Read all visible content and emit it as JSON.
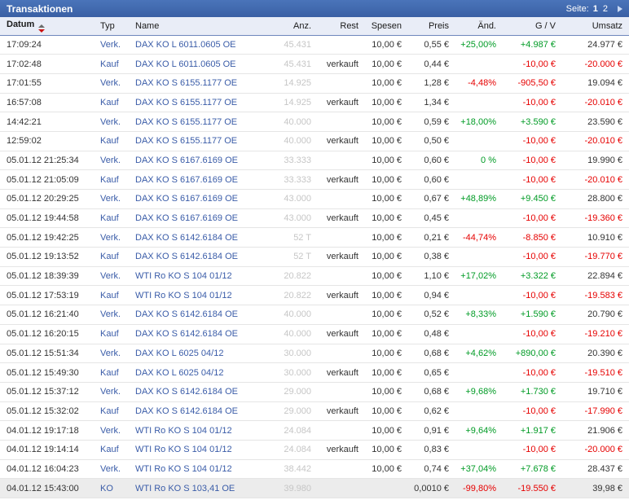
{
  "titlebar": {
    "title": "Transaktionen",
    "page_label": "Seite:",
    "pages": [
      {
        "label": "1",
        "current": true
      },
      {
        "label": "2",
        "current": false
      }
    ],
    "next_page_icon": "next-page-arrow"
  },
  "colors": {
    "titlebar_top": "#4a74ba",
    "titlebar_bottom": "#3a60a4",
    "header_bg": "#e9edf7",
    "link_blue": "#3a5ca8",
    "positive_green": "#009b25",
    "negative_red": "#e60000",
    "muted_grey": "#c6c6c6",
    "highlight_row": "#ececec"
  },
  "table": {
    "columns": [
      "Datum",
      "Typ",
      "Name",
      "Anz.",
      "Rest",
      "Spesen",
      "Preis",
      "Änd.",
      "G / V",
      "Umsatz"
    ],
    "sorted_column": "Datum",
    "sort_icon": "sort-arrows",
    "rows": [
      {
        "datum": "17:09:24",
        "typ": "Verk.",
        "name": "DAX KO L 6011.0605 OE",
        "anz": "45.431",
        "rest": "",
        "spesen": "10,00 €",
        "preis": "0,55 €",
        "aend": "+25,00%",
        "gv": "+4.987 €",
        "umsatz": "24.977 €"
      },
      {
        "datum": "17:02:48",
        "typ": "Kauf",
        "name": "DAX KO L 6011.0605 OE",
        "anz": "45.431",
        "rest": "verkauft",
        "spesen": "10,00 €",
        "preis": "0,44 €",
        "aend": "",
        "gv": "-10,00 €",
        "umsatz": "-20.000 €"
      },
      {
        "datum": "17:01:55",
        "typ": "Verk.",
        "name": "DAX KO S 6155.1177 OE",
        "anz": "14.925",
        "rest": "",
        "spesen": "10,00 €",
        "preis": "1,28 €",
        "aend": "-4,48%",
        "gv": "-905,50 €",
        "umsatz": "19.094 €"
      },
      {
        "datum": "16:57:08",
        "typ": "Kauf",
        "name": "DAX KO S 6155.1177 OE",
        "anz": "14.925",
        "rest": "verkauft",
        "spesen": "10,00 €",
        "preis": "1,34 €",
        "aend": "",
        "gv": "-10,00 €",
        "umsatz": "-20.010 €"
      },
      {
        "datum": "14:42:21",
        "typ": "Verk.",
        "name": "DAX KO S 6155.1177 OE",
        "anz": "40.000",
        "rest": "",
        "spesen": "10,00 €",
        "preis": "0,59 €",
        "aend": "+18,00%",
        "gv": "+3.590 €",
        "umsatz": "23.590 €"
      },
      {
        "datum": "12:59:02",
        "typ": "Kauf",
        "name": "DAX KO S 6155.1177 OE",
        "anz": "40.000",
        "rest": "verkauft",
        "spesen": "10,00 €",
        "preis": "0,50 €",
        "aend": "",
        "gv": "-10,00 €",
        "umsatz": "-20.010 €"
      },
      {
        "datum": "05.01.12 21:25:34",
        "typ": "Verk.",
        "name": "DAX KO S 6167.6169 OE",
        "anz": "33.333",
        "rest": "",
        "spesen": "10,00 €",
        "preis": "0,60 €",
        "aend": "0 %",
        "gv": "-10,00 €",
        "umsatz": "19.990 €"
      },
      {
        "datum": "05.01.12 21:05:09",
        "typ": "Kauf",
        "name": "DAX KO S 6167.6169 OE",
        "anz": "33.333",
        "rest": "verkauft",
        "spesen": "10,00 €",
        "preis": "0,60 €",
        "aend": "",
        "gv": "-10,00 €",
        "umsatz": "-20.010 €"
      },
      {
        "datum": "05.01.12 20:29:25",
        "typ": "Verk.",
        "name": "DAX KO S 6167.6169 OE",
        "anz": "43.000",
        "rest": "",
        "spesen": "10,00 €",
        "preis": "0,67 €",
        "aend": "+48,89%",
        "gv": "+9.450 €",
        "umsatz": "28.800 €"
      },
      {
        "datum": "05.01.12 19:44:58",
        "typ": "Kauf",
        "name": "DAX KO S 6167.6169 OE",
        "anz": "43.000",
        "rest": "verkauft",
        "spesen": "10,00 €",
        "preis": "0,45 €",
        "aend": "",
        "gv": "-10,00 €",
        "umsatz": "-19.360 €"
      },
      {
        "datum": "05.01.12 19:42:25",
        "typ": "Verk.",
        "name": "DAX KO S 6142.6184 OE",
        "anz": "52 T",
        "rest": "",
        "spesen": "10,00 €",
        "preis": "0,21 €",
        "aend": "-44,74%",
        "gv": "-8.850 €",
        "umsatz": "10.910 €"
      },
      {
        "datum": "05.01.12 19:13:52",
        "typ": "Kauf",
        "name": "DAX KO S 6142.6184 OE",
        "anz": "52 T",
        "rest": "verkauft",
        "spesen": "10,00 €",
        "preis": "0,38 €",
        "aend": "",
        "gv": "-10,00 €",
        "umsatz": "-19.770 €"
      },
      {
        "datum": "05.01.12 18:39:39",
        "typ": "Verk.",
        "name": "WTI Ro KO S 104 01/12",
        "anz": "20.822",
        "rest": "",
        "spesen": "10,00 €",
        "preis": "1,10 €",
        "aend": "+17,02%",
        "gv": "+3.322 €",
        "umsatz": "22.894 €"
      },
      {
        "datum": "05.01.12 17:53:19",
        "typ": "Kauf",
        "name": "WTI Ro KO S 104 01/12",
        "anz": "20.822",
        "rest": "verkauft",
        "spesen": "10,00 €",
        "preis": "0,94 €",
        "aend": "",
        "gv": "-10,00 €",
        "umsatz": "-19.583 €"
      },
      {
        "datum": "05.01.12 16:21:40",
        "typ": "Verk.",
        "name": "DAX KO S 6142.6184 OE",
        "anz": "40.000",
        "rest": "",
        "spesen": "10,00 €",
        "preis": "0,52 €",
        "aend": "+8,33%",
        "gv": "+1.590 €",
        "umsatz": "20.790 €"
      },
      {
        "datum": "05.01.12 16:20:15",
        "typ": "Kauf",
        "name": "DAX KO S 6142.6184 OE",
        "anz": "40.000",
        "rest": "verkauft",
        "spesen": "10,00 €",
        "preis": "0,48 €",
        "aend": "",
        "gv": "-10,00 €",
        "umsatz": "-19.210 €"
      },
      {
        "datum": "05.01.12 15:51:34",
        "typ": "Verk.",
        "name": "DAX KO L 6025 04/12",
        "anz": "30.000",
        "rest": "",
        "spesen": "10,00 €",
        "preis": "0,68 €",
        "aend": "+4,62%",
        "gv": "+890,00 €",
        "umsatz": "20.390 €"
      },
      {
        "datum": "05.01.12 15:49:30",
        "typ": "Kauf",
        "name": "DAX KO L 6025 04/12",
        "anz": "30.000",
        "rest": "verkauft",
        "spesen": "10,00 €",
        "preis": "0,65 €",
        "aend": "",
        "gv": "-10,00 €",
        "umsatz": "-19.510 €"
      },
      {
        "datum": "05.01.12 15:37:12",
        "typ": "Verk.",
        "name": "DAX KO S 6142.6184 OE",
        "anz": "29.000",
        "rest": "",
        "spesen": "10,00 €",
        "preis": "0,68 €",
        "aend": "+9,68%",
        "gv": "+1.730 €",
        "umsatz": "19.710 €"
      },
      {
        "datum": "05.01.12 15:32:02",
        "typ": "Kauf",
        "name": "DAX KO S 6142.6184 OE",
        "anz": "29.000",
        "rest": "verkauft",
        "spesen": "10,00 €",
        "preis": "0,62 €",
        "aend": "",
        "gv": "-10,00 €",
        "umsatz": "-17.990 €"
      },
      {
        "datum": "04.01.12 19:17:18",
        "typ": "Verk.",
        "name": "WTI Ro KO S 104 01/12",
        "anz": "24.084",
        "rest": "",
        "spesen": "10,00 €",
        "preis": "0,91 €",
        "aend": "+9,64%",
        "gv": "+1.917 €",
        "umsatz": "21.906 €"
      },
      {
        "datum": "04.01.12 19:14:14",
        "typ": "Kauf",
        "name": "WTI Ro KO S 104 01/12",
        "anz": "24.084",
        "rest": "verkauft",
        "spesen": "10,00 €",
        "preis": "0,83 €",
        "aend": "",
        "gv": "-10,00 €",
        "umsatz": "-20.000 €"
      },
      {
        "datum": "04.01.12 16:04:23",
        "typ": "Verk.",
        "name": "WTI Ro KO S 104 01/12",
        "anz": "38.442",
        "rest": "",
        "spesen": "10,00 €",
        "preis": "0,74 €",
        "aend": "+37,04%",
        "gv": "+7.678 €",
        "umsatz": "28.437 €"
      },
      {
        "datum": "04.01.12 15:43:00",
        "typ": "KO",
        "name": "WTI Ro KO S 103,41 OE",
        "anz": "39.980",
        "rest": "",
        "spesen": "",
        "preis": "0,0010 €",
        "aend": "-99,80%",
        "gv": "-19.550 €",
        "umsatz": "39,98 €",
        "highlight": true
      }
    ]
  }
}
